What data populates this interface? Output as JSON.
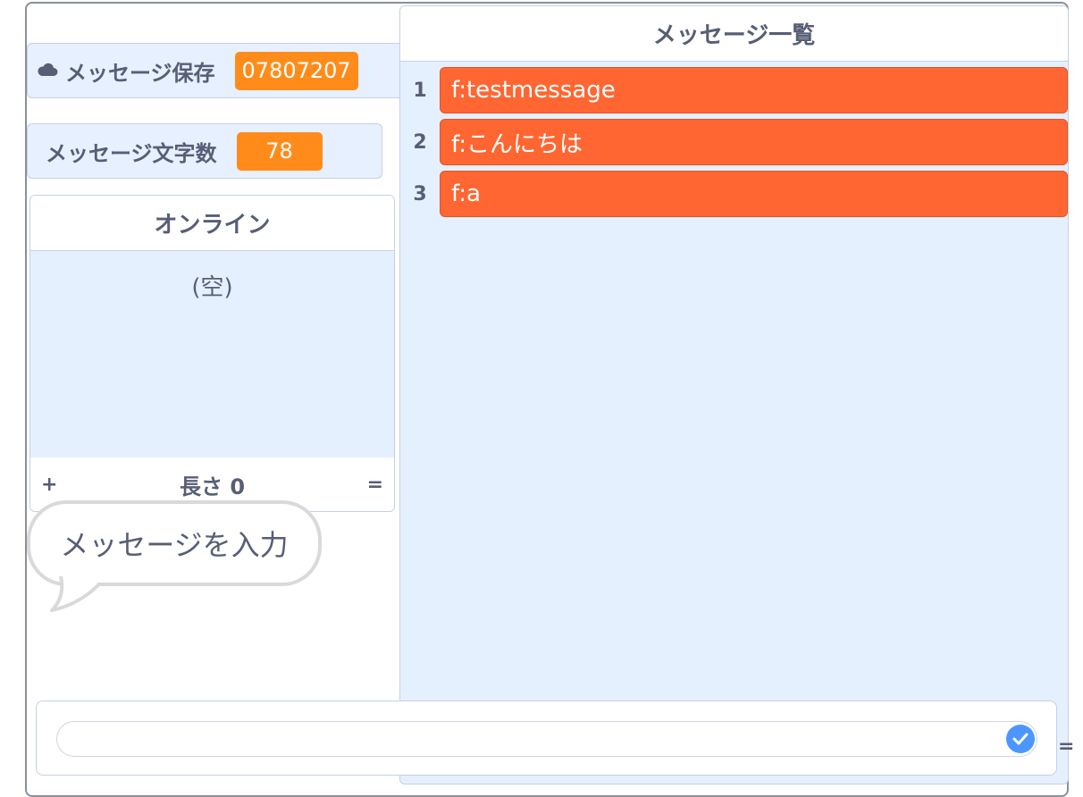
{
  "monitors": {
    "message_save": {
      "label": "メッセージ保存",
      "value": "07807207",
      "icon": "cloud-icon"
    },
    "message_length": {
      "label": "メッセージ文字数",
      "value": "78"
    }
  },
  "online_list": {
    "title": "オンライン",
    "empty_text": "(空)",
    "add_symbol": "+",
    "length_label": "長さ 0",
    "resize_symbol": "="
  },
  "message_list": {
    "title": "メッセージ一覧",
    "items": [
      {
        "index": "1",
        "text": "f:testmessage"
      },
      {
        "index": "2",
        "text": "f:こんにちは"
      },
      {
        "index": "3",
        "text": "f:a"
      }
    ],
    "resize_symbol": "="
  },
  "bubble": {
    "text": "メッセージを入力"
  },
  "ask": {
    "value": "",
    "submit_icon": "check-icon"
  },
  "colors": {
    "variable_value": "#ff8c1a",
    "list_item": "#ff6632",
    "monitor_bg": "#e6f0ff",
    "check_button": "#4c97ff"
  }
}
